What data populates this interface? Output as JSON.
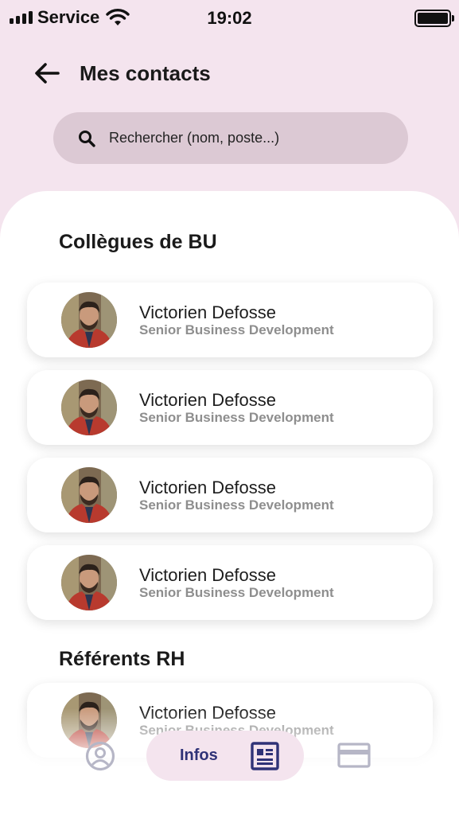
{
  "status_bar": {
    "carrier": "Service",
    "time": "19:02",
    "icons": [
      "signal-icon",
      "wifi-icon",
      "battery-icon"
    ]
  },
  "header": {
    "back_icon": "arrow-left-icon",
    "title": "Mes contacts"
  },
  "search": {
    "icon": "search-icon",
    "placeholder": "Rechercher (nom, poste...)",
    "value": ""
  },
  "sections": [
    {
      "title": "Collègues de BU",
      "contacts": [
        {
          "name": "Victorien Defosse",
          "role": "Senior Business Development"
        },
        {
          "name": "Victorien Defosse",
          "role": "Senior Business Development"
        },
        {
          "name": "Victorien Defosse",
          "role": "Senior Business Development"
        },
        {
          "name": "Victorien Defosse",
          "role": "Senior Business Development"
        }
      ]
    },
    {
      "title": "Référents RH",
      "contacts": [
        {
          "name": "Victorien Defosse",
          "role": "Senior Business Development"
        }
      ]
    }
  ],
  "bottom_nav": {
    "profile_icon": "user-circle-icon",
    "active_label": "Infos",
    "active_icon": "contact-card-icon",
    "card_icon": "credit-card-icon"
  },
  "colors": {
    "background": "#f4e4ee",
    "search_bg": "#dcc9d4",
    "accent": "#2f3277",
    "inactive_icon": "#b6b6c6",
    "role_text": "#8e8e8e"
  }
}
